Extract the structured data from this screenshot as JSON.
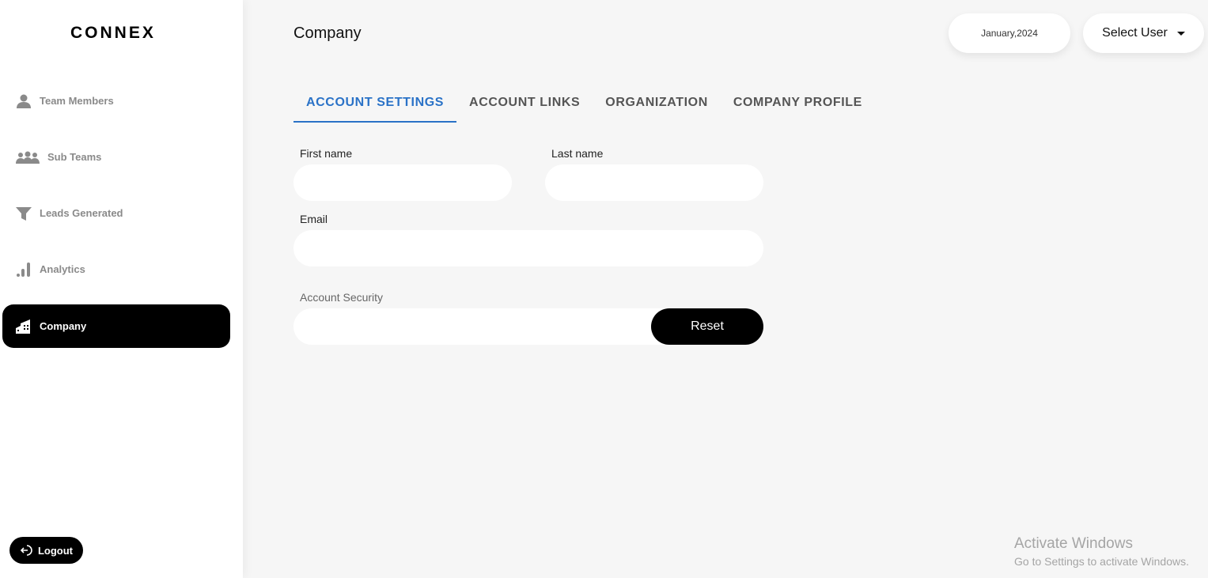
{
  "brand": "CONNEX",
  "sidebar": {
    "items": [
      {
        "label": "Team Members"
      },
      {
        "label": "Sub Teams"
      },
      {
        "label": "Leads Generated"
      },
      {
        "label": "Analytics"
      },
      {
        "label": "Company"
      }
    ],
    "logout": "Logout"
  },
  "header": {
    "title": "Company",
    "date": "January,2024",
    "user_select": "Select User"
  },
  "tabs": [
    "ACCOUNT SETTINGS",
    "ACCOUNT LINKS",
    "ORGANIZATION",
    "COMPANY PROFILE"
  ],
  "form": {
    "first_name_label": "First name",
    "first_name": "",
    "last_name_label": "Last name",
    "last_name": "",
    "email_label": "Email",
    "email": "",
    "security_label": "Account Security",
    "reset": "Reset"
  },
  "watermark": {
    "title": "Activate Windows",
    "sub": "Go to Settings to activate Windows."
  }
}
